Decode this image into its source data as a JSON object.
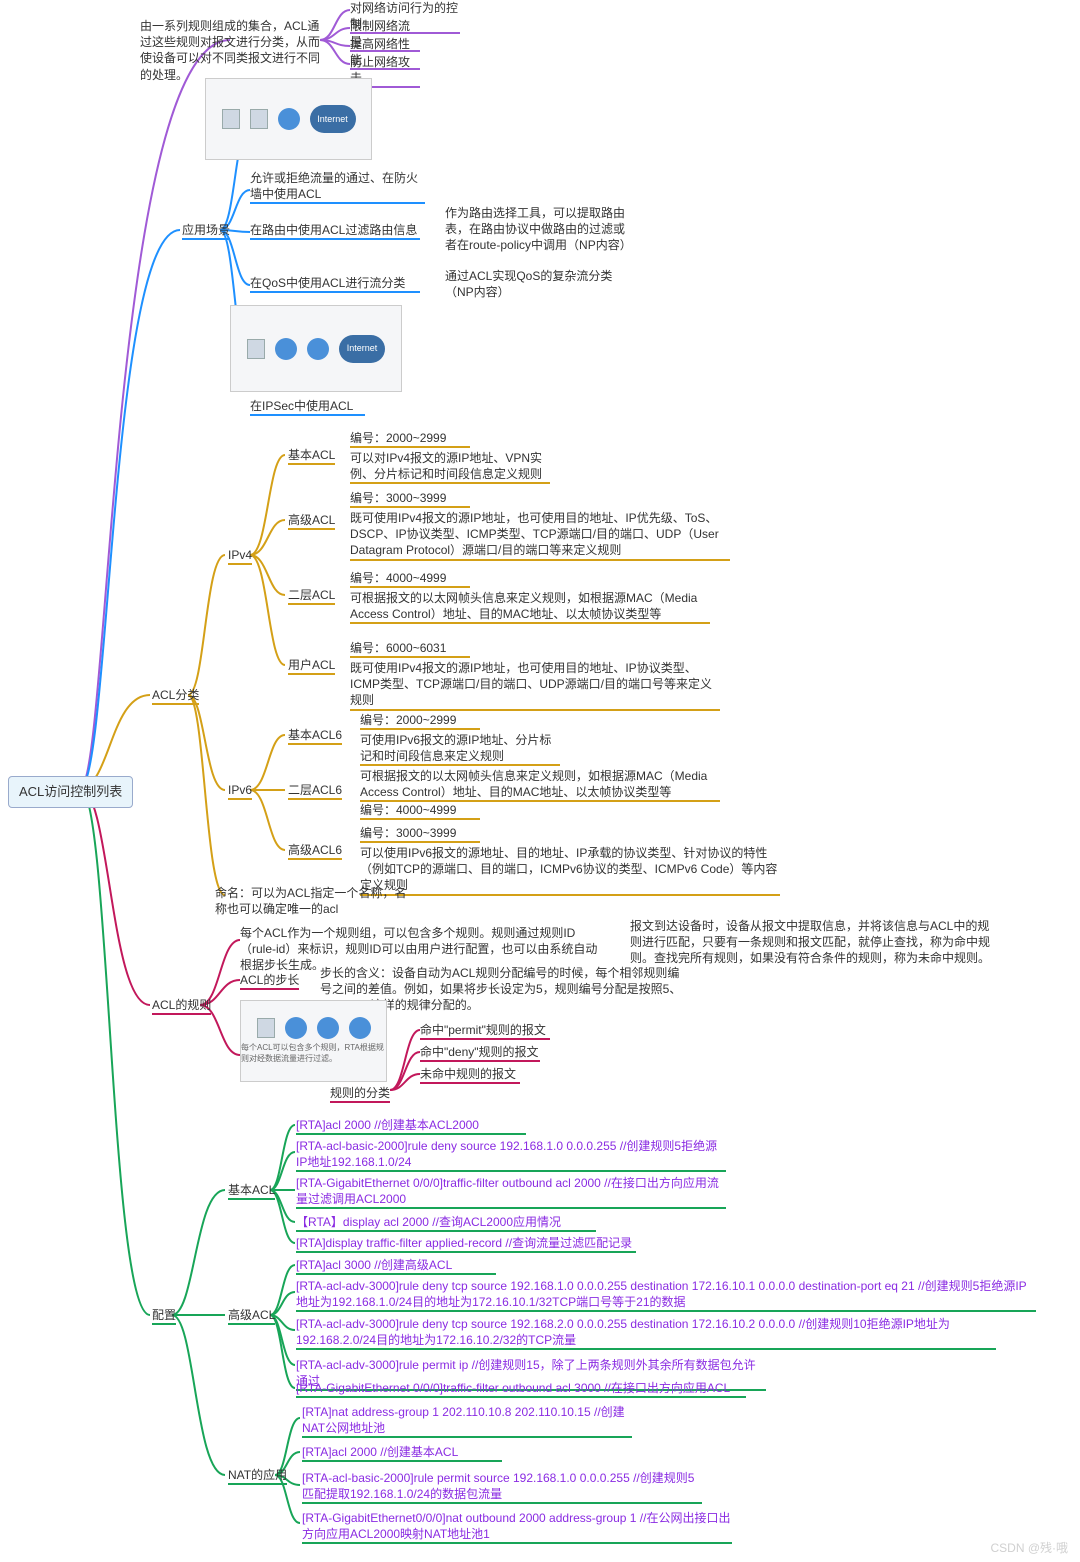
{
  "root": "ACL访问控制列表",
  "intro": "由一系列规则组成的集合，ACL通过这些规则对报文进行分类，从而使设备可以对不同类报文进行不同的处理。",
  "goals": {
    "g1": "对网络访问行为的控制",
    "g2": "限制网络流量",
    "g3": "提高网络性能",
    "g4": "防止网络攻击"
  },
  "scene": {
    "title": "应用场景",
    "firewall": "允许或拒绝流量的通过、在防火墙中使用ACL",
    "route": "在路由中使用ACL过滤路由信息",
    "route_note": "作为路由选择工具，可以提取路由表，在路由协议中做路由的过滤或者在route-policy中调用（NP内容）",
    "qos": "在QoS中使用ACL进行流分类",
    "qos_note": "通过ACL实现QoS的复杂流分类（NP内容）",
    "ipsec": "在IPSec中使用ACL"
  },
  "cls": {
    "title": "ACL分类",
    "ipv4": "IPv4",
    "ipv6": "IPv6",
    "basic": "基本ACL",
    "basic_num": "编号：2000~2999",
    "basic_desc": "可以对IPv4报文的源IP地址、VPN实例、分片标记和时间段信息定义规则",
    "adv": "高级ACL",
    "adv_num": "编号：3000~3999",
    "adv_desc": "既可使用IPv4报文的源IP地址，也可使用目的地址、IP优先级、ToS、DSCP、IP协议类型、ICMP类型、TCP源端口/目的端口、UDP（User Datagram Protocol）源端口/目的端口等来定义规则",
    "l2": "二层ACL",
    "l2_num": "编号：4000~4999",
    "l2_desc": "可根据报文的以太网帧头信息来定义规则，如根据源MAC（Media Access Control）地址、目的MAC地址、以太帧协议类型等",
    "user": "用户ACL",
    "user_num": "编号：6000~6031",
    "user_desc": "既可使用IPv4报文的源IP地址，也可使用目的地址、IP协议类型、ICMP类型、TCP源端口/目的端口、UDP源端口/目的端口号等来定义规则",
    "basic6": "基本ACL6",
    "basic6_num": "编号：2000~2999",
    "basic6_desc": "可使用IPv6报文的源IP地址、分片标记和时间段信息来定义规则",
    "l26": "二层ACL6",
    "l26_num2": "编号：4000~4999",
    "l26_desc": "可根据报文的以太网帧头信息来定义规则，如根据源MAC（Media Access Control）地址、目的MAC地址、以太帧协议类型等",
    "adv6": "高级ACL6",
    "adv6_num": "编号：3000~3999",
    "adv6_desc": "可以使用IPv6报文的源地址、目的地址、IP承载的协议类型、针对协议的特性（例如TCP的源端口、目的端口，ICMPv6协议的类型、ICMPv6 Code）等内容定义规则",
    "naming": "命名：可以为ACL指定一个名称，名称也可以确定唯一的acl"
  },
  "rule": {
    "title": "ACL的规则",
    "group": "每个ACL作为一个规则组，可以包含多个规则。规则通过规则ID（rule-id）来标识，规则ID可以由用户进行配置，也可以由系统自动根据步长生成。",
    "match": "报文到达设备时，设备从报文中提取信息，并将该信息与ACL中的规则进行匹配，只要有一条规则和报文匹配，就停止查找，称为命中规则。查找完所有规则，如果没有符合条件的规则，称为未命中规则。",
    "step_t": "ACL的步长",
    "step": "步长的含义：设备自动为ACL规则分配编号的时候，每个相邻规则编号之间的差值。例如，如果将步长设定为5，规则编号分配是按照5、10、15…这样的规律分配的。",
    "kind_t": "规则的分类",
    "permit": "命中\"permit\"规则的报文",
    "deny": "命中\"deny\"规则的报文",
    "miss": "未命中规则的报文",
    "img_note": "每个ACL可以包含多个规则，RTA根据规则对经数据流量进行过滤。"
  },
  "cfg": {
    "title": "配置",
    "basic_t": "基本ACL",
    "b1": "[RTA]acl 2000   //创建基本ACL2000",
    "b2": "[RTA-acl-basic-2000]rule deny source 192.168.1.0 0.0.0.255   //创建规则5拒绝源IP地址192.168.1.0/24",
    "b3": "[RTA-GigabitEthernet 0/0/0]traffic-filter outbound acl 2000   //在接口出方向应用流量过滤调用ACL2000",
    "b4": "【RTA】display acl 2000   //查询ACL2000应用情况",
    "b5": "[RTA]display  traffic-filter applied-record   //查询流量过滤匹配记录",
    "adv_t": "高级ACL",
    "a1": "[RTA]acl 3000   //创建高级ACL",
    "a2": "[RTA-acl-adv-3000]rule deny tcp source 192.168.1.0 0.0.0.255 destination 172.16.10.1 0.0.0.0 destination-port eq 21   //创建规则5拒绝源IP地址为192.168.1.0/24目的地址为172.16.10.1/32TCP端口号等于21的数据",
    "a3": "[RTA-acl-adv-3000]rule deny tcp source 192.168.2.0 0.0.0.255 destination 172.16.10.2 0.0.0.0   //创建规则10拒绝源IP地址为192.168.2.0/24目的地址为172.16.10.2/32的TCP流量",
    "a4": "[RTA-acl-adv-3000]rule permit ip   //创建规则15，除了上两条规则外其余所有数据包允许通过",
    "a5": "[RTA-GigabitEthernet 0/0/0]traffic-filter outbound acl 3000   //在接口出方向应用ACL",
    "nat_t": "NAT的应用",
    "n1": "[RTA]nat address-group 1 202.110.10.8 202.110.10.15   //创建NAT公网地址池",
    "n2": "[RTA]acl 2000   //创建基本ACL",
    "n3": "[RTA-acl-basic-2000]rule permit source 192.168.1.0 0.0.0.255   //创建规则5匹配提取192.168.1.0/24的数据包流量",
    "n4": "[RTA-GigabitEthernet0/0/0]nat outbound 2000 address-group 1   //在公网出接口出方向应用ACL2000映射NAT地址池1"
  },
  "watermark": "CSDN @残·哦",
  "internet": "Internet"
}
